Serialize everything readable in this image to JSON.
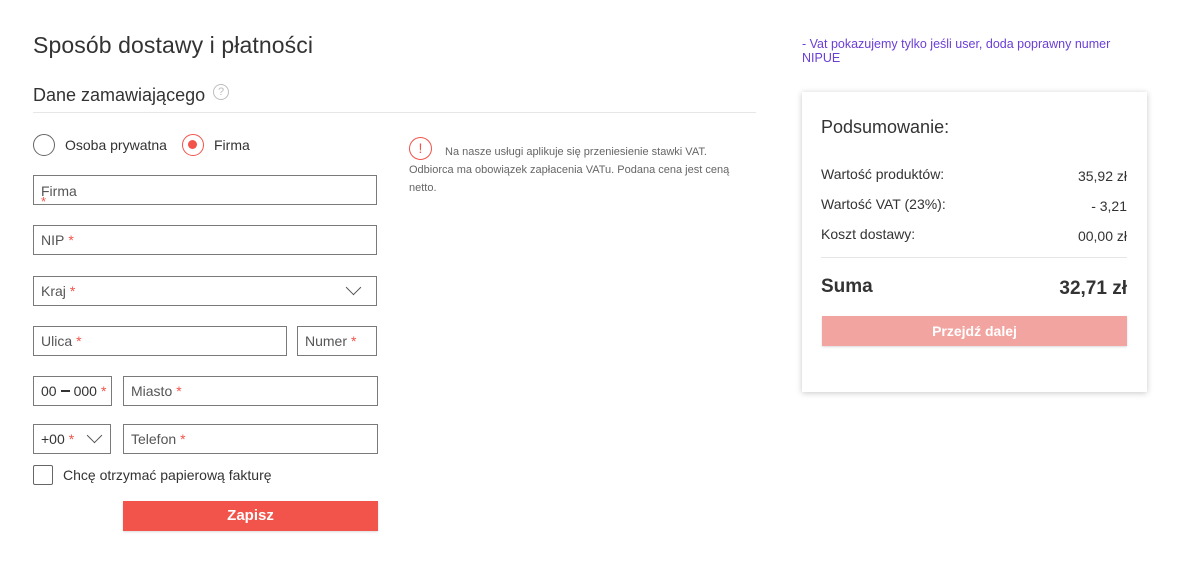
{
  "page": {
    "title": "Sposób dostawy i płatności",
    "section_title": "Dane zamawiającego",
    "help_glyph": "?"
  },
  "customer_type": {
    "options": [
      {
        "label": "Osoba prywatna",
        "selected": false
      },
      {
        "label": "Firma",
        "selected": true
      }
    ]
  },
  "form": {
    "company": {
      "label": "Firma",
      "required_mark": "*"
    },
    "nip": {
      "label": "NIP",
      "required_mark": "*"
    },
    "country": {
      "label": "Kraj",
      "required_mark": "*"
    },
    "street": {
      "label": "Ulica",
      "required_mark": "*"
    },
    "number": {
      "label": "Numer",
      "required_mark": "*"
    },
    "postcode": {
      "part1": "00",
      "part2": "000",
      "required_mark": "*"
    },
    "city": {
      "label": "Miasto",
      "required_mark": "*"
    },
    "phone_prefix": {
      "label": "+00",
      "required_mark": "*"
    },
    "phone": {
      "label": "Telefon",
      "required_mark": "*"
    },
    "paper_invoice": {
      "label": "Chcę otrzymać papierową fakturę",
      "checked": false
    },
    "save_label": "Zapisz"
  },
  "vat_notice": {
    "icon_glyph": "!",
    "text": "Na nasze usługi aplikuje się przeniesienie stawki VAT. Odbiorca ma obowiązek zapłacenia VATu. Podana cena jest ceną netto."
  },
  "dev_note": "- Vat pokazujemy tylko jeśli user, doda poprawny numer NIPUE",
  "summary": {
    "title": "Podsumowanie:",
    "rows": [
      {
        "label": "Wartość produktów:",
        "value": "35,92 zł"
      },
      {
        "label": "Wartość VAT (23%):",
        "value": "- 3,21"
      },
      {
        "label": "Koszt dostawy:",
        "value": "00,00 zł"
      }
    ],
    "total_label": "Suma",
    "total_value": "32,71 zł",
    "next_label": "Przejdź dalej"
  },
  "colors": {
    "accent": "#f2534a",
    "accent_disabled": "#f2a5a0",
    "dev_note": "#6b3fd6"
  }
}
